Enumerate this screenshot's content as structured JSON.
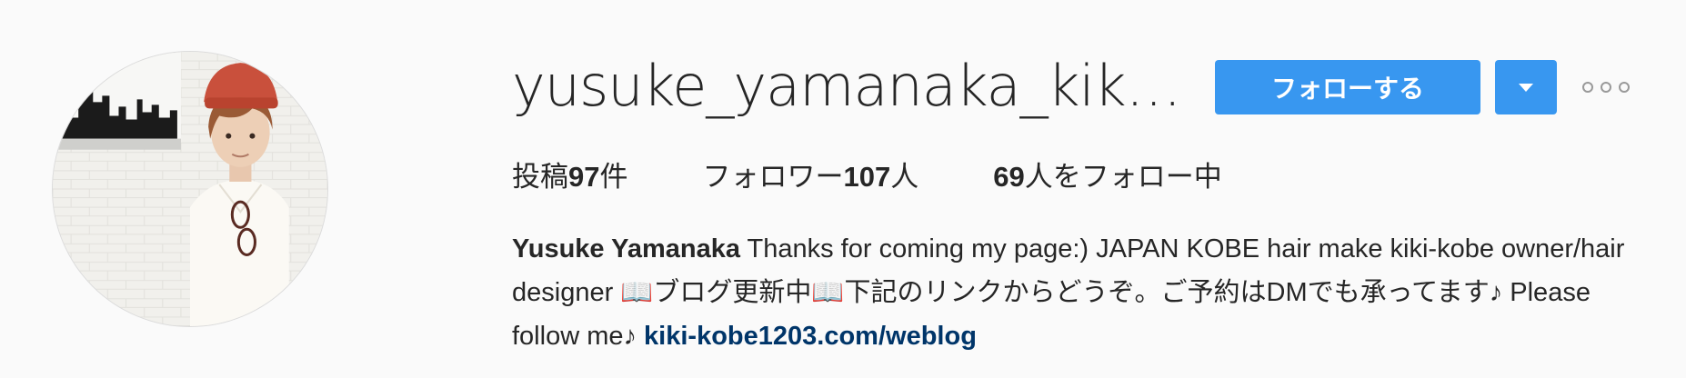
{
  "profile": {
    "username": "yusuke_yamanaka_kiki...",
    "follow_label": "フォローする",
    "dropdown_icon": "caret-down-icon",
    "options_icon": "more-options-icon"
  },
  "stats": {
    "posts_prefix": "投稿",
    "posts_count": "97",
    "posts_suffix": "件",
    "followers_prefix": "フォロワー",
    "followers_count": "107",
    "followers_suffix": "人",
    "following_count": "69",
    "following_suffix": "人をフォロー中"
  },
  "bio": {
    "full_name": "Yusuke Yamanaka",
    "text": " Thanks for coming my page:) JAPAN KOBE hair make kiki-kobe owner/hair designer 📖ブログ更新中📖下記のリンクからどうぞ。ご予約はDMでも承ってます♪ Please follow me♪ ",
    "link": "kiki-kobe1203.com/weblog"
  },
  "colors": {
    "accent": "#3897f0",
    "link": "#003569",
    "background": "#fafafa",
    "text": "#262626"
  }
}
